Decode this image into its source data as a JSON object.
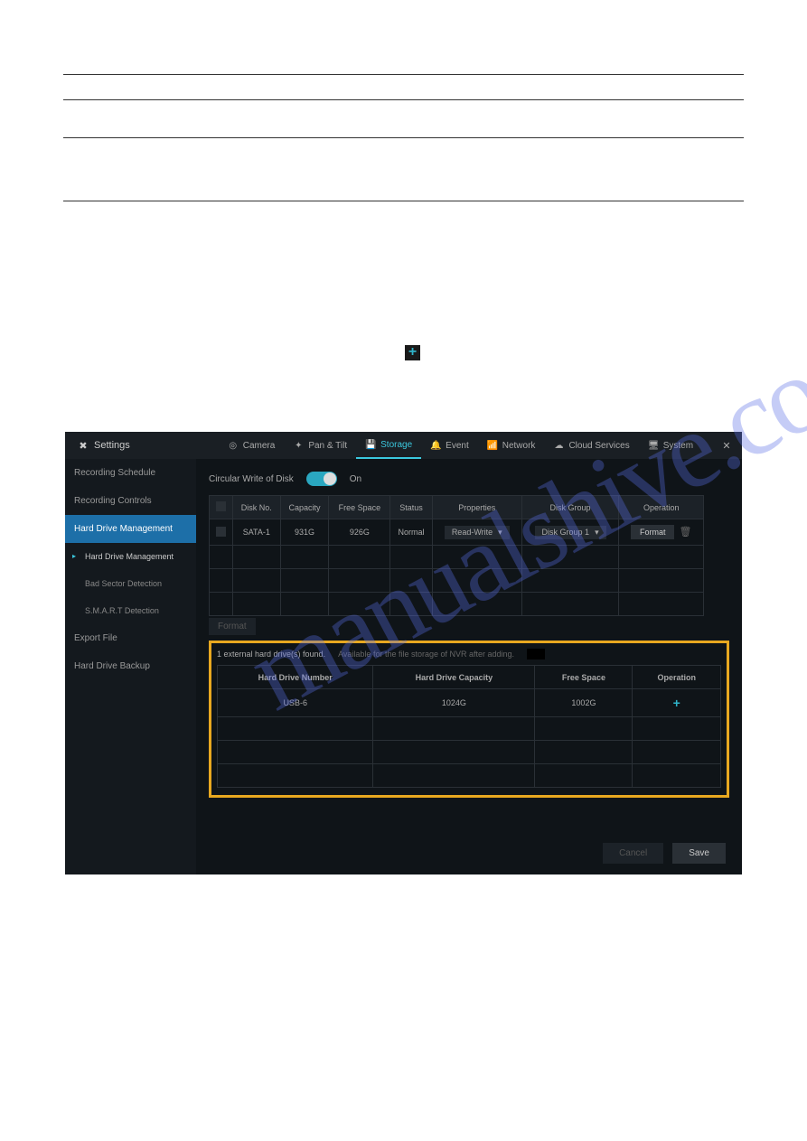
{
  "plus_badge": "+",
  "app": {
    "title": "Settings",
    "tabs": [
      {
        "icon": "◎",
        "label": "Camera"
      },
      {
        "icon": "✦",
        "label": "Pan & Tilt"
      },
      {
        "icon": "💾",
        "label": "Storage"
      },
      {
        "icon": "🔔",
        "label": "Event"
      },
      {
        "icon": "📶",
        "label": "Network"
      },
      {
        "icon": "☁",
        "label": "Cloud Services"
      },
      {
        "icon": "🖥",
        "label": "System"
      }
    ],
    "sidebar": {
      "items": [
        "Recording Schedule",
        "Recording Controls",
        "Hard Drive Management"
      ],
      "subs": [
        "Hard Drive Management",
        "Bad Sector Detection",
        "S.M.A.R.T Detection"
      ],
      "tail": [
        "Export File",
        "Hard Drive Backup"
      ]
    },
    "circular_label": "Circular Write of Disk",
    "circular_state": "On",
    "disk_headers": [
      "",
      "Disk No.",
      "Capacity",
      "Free Space",
      "Status",
      "Properties",
      "Disk Group",
      "Operation"
    ],
    "disk_row": {
      "no": "SATA-1",
      "cap": "931G",
      "free": "926G",
      "status": "Normal",
      "prop": "Read-Write",
      "group": "Disk Group 1",
      "op": "Format"
    },
    "format_btn_below": "Format",
    "ext_found": "1 external hard drive(s) found.",
    "ext_note": "Available for the file storage of NVR after adding.",
    "ext_headers": [
      "Hard Drive Number",
      "Hard Drive Capacity",
      "Free Space",
      "Operation"
    ],
    "ext_row": {
      "num": "USB-6",
      "cap": "1024G",
      "free": "1002G",
      "op": "+"
    },
    "cancel": "Cancel",
    "save": "Save"
  }
}
